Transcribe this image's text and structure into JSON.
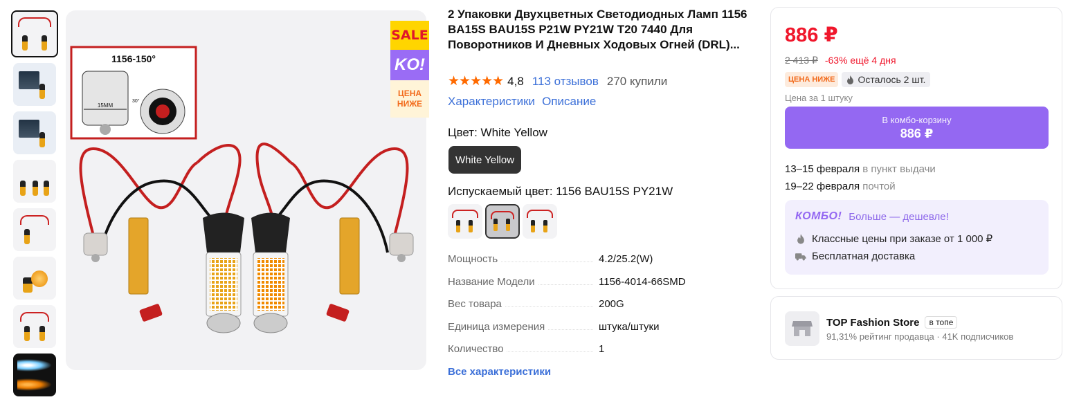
{
  "badge": {
    "sale": "SALE",
    "ko": "KO!",
    "lower_line1": "ЦЕНА",
    "lower_line2": "НИЖЕ"
  },
  "image_labels": {
    "angle": "1156-150°",
    "size": "15MM",
    "deg": "30°"
  },
  "product": {
    "title": "2 Упаковки Двухцветных Светодиодных Ламп 1156 BA15S BAU15S P21W PY21W T20 7440 Для Поворотников И Дневных Ходовых Огней (DRL)...",
    "stars": "★★★★★",
    "rating": "4,8",
    "reviews": "113 отзывов",
    "bought": "270 купили",
    "links": {
      "specs": "Характеристики",
      "description": "Описание"
    },
    "color_label": "Цвет: White Yellow",
    "color_option": "White Yellow",
    "emit_label": "Испускаемый цвет: 1156 BAU15S PY21W",
    "specs": [
      {
        "key": "Мощность",
        "value": "4.2/25.2(W)"
      },
      {
        "key": "Название Модели",
        "value": "1156-4014-66SMD"
      },
      {
        "key": "Вес товара",
        "value": "200G"
      },
      {
        "key": "Единица измерения",
        "value": "штука/штуки"
      },
      {
        "key": "Количество",
        "value": "1"
      }
    ],
    "all_specs": "Все характеристики"
  },
  "buy": {
    "price": "886 ₽",
    "old_price": "2 413 ₽",
    "discount": "-63% ещё 4 дня",
    "badge_lower": "ЦЕНА НИЖЕ",
    "badge_left": "Осталось 2 шт.",
    "per_unit": "Цена за 1 штуку",
    "combo_btn_l1": "В комбо-корзину",
    "combo_btn_l2": "886 ₽",
    "delivery1_date": "13–15 февраля",
    "delivery1_where": "в пункт выдачи",
    "delivery2_date": "19–22 февраля",
    "delivery2_where": "почтой",
    "combo_logo": "КОМБО!",
    "combo_title": "Больше — дешевле!",
    "combo_line1": "Классные цены при заказе от 1 000 ₽",
    "combo_line2": "Бесплатная доставка"
  },
  "store": {
    "name": "TOP Fashion Store",
    "tag": "в топе",
    "meta": "91,31% рейтинг продавца · 41K подписчиков"
  },
  "colors": {
    "accent": "#9468f2",
    "price_red": "#f0162b",
    "link": "#3b6fd8",
    "star": "#ff6a00"
  }
}
